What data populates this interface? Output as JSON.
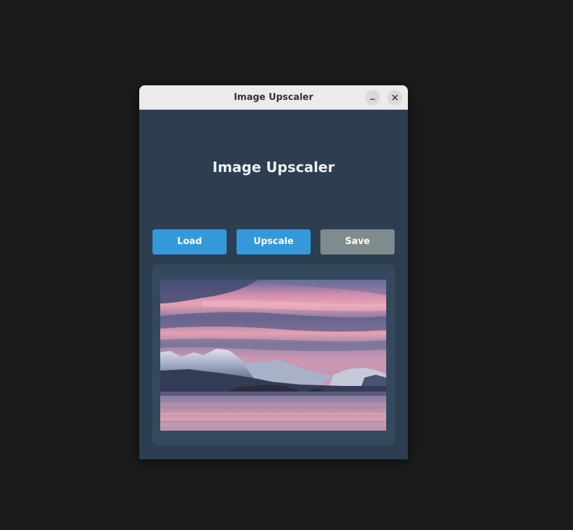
{
  "window": {
    "title": "Image Upscaler",
    "minimize_icon": "minimize-icon",
    "close_icon": "close-icon"
  },
  "app": {
    "heading": "Image Upscaler",
    "buttons": {
      "load_label": "Load",
      "upscale_label": "Upscale",
      "save_label": "Save"
    },
    "preview": {
      "description_icon": "landscape-photo"
    }
  },
  "colors": {
    "desktop_background": "#1b1b1b",
    "window_background": "#2c3e50",
    "panel_background": "#34495e",
    "primary_button": "#3498db",
    "disabled_button": "#7f8c8d",
    "heading_text": "#ecf0f1",
    "titlebar": "#ebebeb"
  }
}
